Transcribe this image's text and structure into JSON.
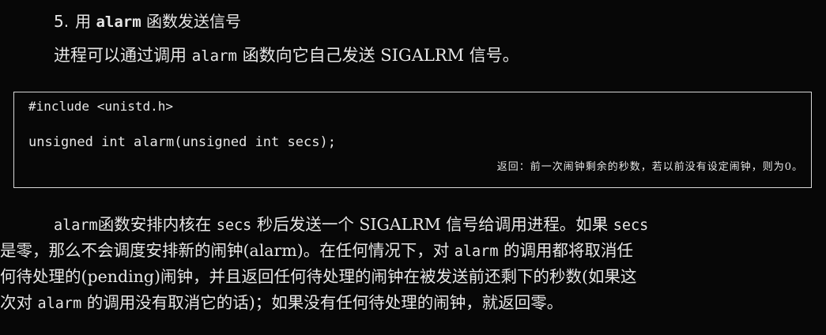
{
  "heading": {
    "number": "5.",
    "pre": "用",
    "code": "alarm",
    "post": "函数发送信号"
  },
  "intro": {
    "pre": "进程可以通过调用",
    "code": "alarm",
    "post": "函数向它自己发送 SIGALRM 信号。"
  },
  "code_box": {
    "line1": "#include <unistd.h>",
    "line2": "unsigned int alarm(unsigned int secs);",
    "returns": "返回：前一次闹钟剩余的秒数，若以前没有设定闹钟，则为0。"
  },
  "paragraph": {
    "l1_code1": "alarm",
    "l1_text1": "函数安排内核在",
    "l1_code2": "secs",
    "l1_text2": "秒后发送一个 SIGALRM 信号给调用进程。如果",
    "l1_code3": "secs",
    "l2_text1": "是零，那么不会调度安排新的闹钟(alarm)。在任何情况下，对",
    "l2_code1": "alarm",
    "l2_text2": "的调用都将取消任",
    "l3_text1": "何待处理的(pending)闹钟，并且返回任何待处理的闹钟在被发送前还剩下的秒数(如果这",
    "l4_text1": "次对",
    "l4_code1": "alarm",
    "l4_text2": "的调用没有取消它的话)；如果没有任何待处理的闹钟，就返回零。"
  }
}
